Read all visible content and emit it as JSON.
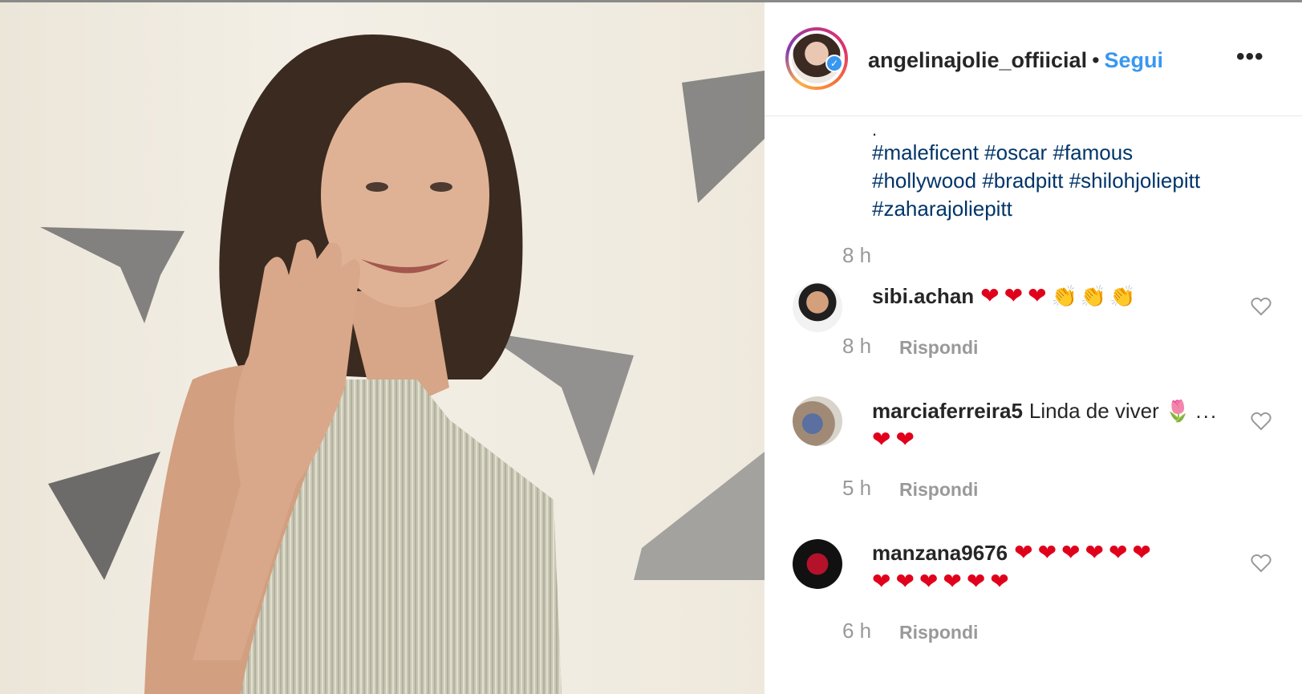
{
  "post": {
    "username": "angelinajolie_offiicial",
    "separator": "•",
    "follow_label": "Segui",
    "more_label": "•••",
    "verified_icon": "✓",
    "caption_dot": ".",
    "hashtags_line1": "#maleficent #oscar #famous",
    "hashtags_line2": "#hollywood #bradpitt #shilohjoliepitt",
    "hashtags_line3": "#zaharajoliepitt",
    "time": "8 h"
  },
  "comments": [
    {
      "user": "sibi.achan",
      "hearts": "❤❤❤",
      "claps": "👏👏👏",
      "time": "8 h",
      "reply_label": "Rispondi"
    },
    {
      "user": "marciaferreira5",
      "text": "Linda de viver",
      "tulip": "🌷",
      "ellipsis": "...",
      "hearts": "❤❤",
      "time": "5 h",
      "reply_label": "Rispondi"
    },
    {
      "user": "manzana9676",
      "hearts_line1": "❤❤❤❤❤❤",
      "hearts_line2": "❤❤❤❤❤❤",
      "time": "6 h",
      "reply_label": "Rispondi"
    }
  ],
  "colors": {
    "link": "#003569",
    "follow": "#3897f0",
    "muted": "#999999",
    "heart": "#e0001b"
  },
  "icons": {
    "like": "heart-outline-icon",
    "more": "more-horizontal-icon",
    "verified": "verified-badge-icon"
  }
}
